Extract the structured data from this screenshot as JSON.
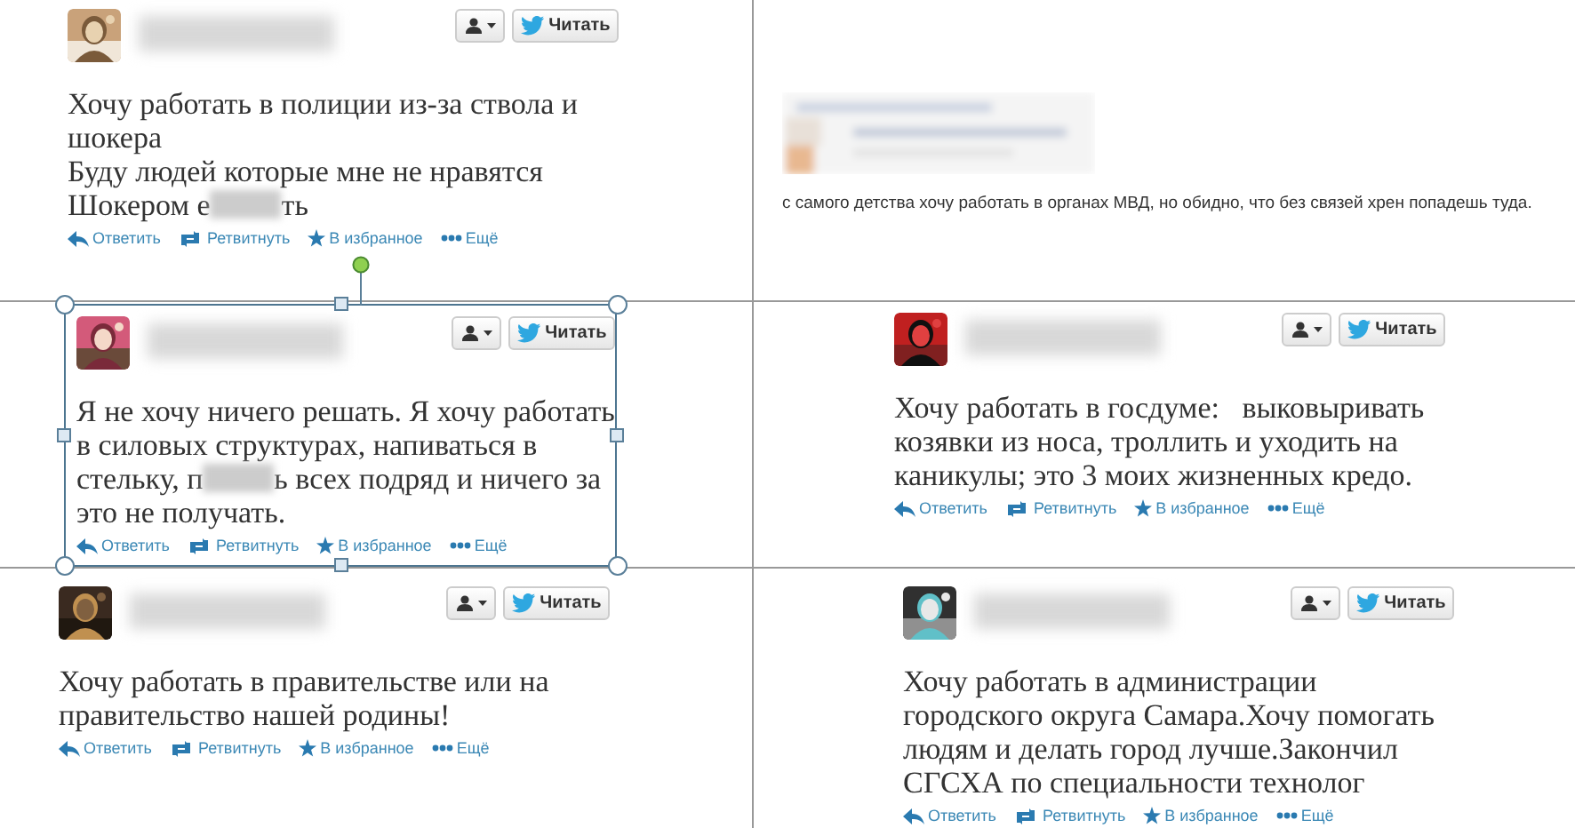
{
  "tweets": [
    {
      "kind": "tweet",
      "selected": false,
      "follow_label": "Читать",
      "lines": [
        [
          {
            "kind": "text",
            "text": "Хочу работать в полиции из-за ствола и"
          }
        ],
        [
          {
            "kind": "text",
            "text": "шокера"
          }
        ],
        [
          {
            "kind": "text",
            "text": "Буду людей которые мне не нравятся"
          }
        ],
        [
          {
            "kind": "text",
            "text": "Шокером е"
          },
          {
            "kind": "censored"
          },
          {
            "kind": "text",
            "text": "ть"
          }
        ]
      ],
      "actions": [
        {
          "kind": "reply",
          "label": "Ответить"
        },
        {
          "kind": "retweet",
          "label": "Ретвитнуть"
        },
        {
          "kind": "favorite",
          "label": "В избранное"
        },
        {
          "kind": "more",
          "label": "Ещё"
        }
      ]
    },
    {
      "kind": "post",
      "selected": false,
      "lines": [
        [
          {
            "kind": "text",
            "text": "с самого детства хочу работать в органах МВД, но обидно, что без связей хрен попадешь туда."
          }
        ]
      ]
    },
    {
      "kind": "tweet",
      "selected": true,
      "follow_label": "Читать",
      "lines": [
        [
          {
            "kind": "text",
            "text": "Я не хочу ничего решать. Я хочу работать"
          }
        ],
        [
          {
            "kind": "text",
            "text": "в силовых структурах, напиваться в"
          }
        ],
        [
          {
            "kind": "text",
            "text": "стельку, п"
          },
          {
            "kind": "censored"
          },
          {
            "kind": "text",
            "text": "ь всех подряд и ничего за"
          }
        ],
        [
          {
            "kind": "text",
            "text": "это не получать."
          }
        ]
      ],
      "actions": [
        {
          "kind": "reply",
          "label": "Ответить"
        },
        {
          "kind": "retweet",
          "label": "Ретвитнуть"
        },
        {
          "kind": "favorite",
          "label": "В избранное"
        },
        {
          "kind": "more",
          "label": "Ещё"
        }
      ]
    },
    {
      "kind": "tweet",
      "selected": false,
      "follow_label": "Читать",
      "lines": [
        [
          {
            "kind": "text",
            "text": "Хочу работать в госдуме:   выковыривать"
          }
        ],
        [
          {
            "kind": "text",
            "text": "козявки из носа, троллить и уходить на"
          }
        ],
        [
          {
            "kind": "text",
            "text": "каникулы; это 3 моих жизненных кредо."
          }
        ]
      ],
      "actions": [
        {
          "kind": "reply",
          "label": "Ответить"
        },
        {
          "kind": "retweet",
          "label": "Ретвитнуть"
        },
        {
          "kind": "favorite",
          "label": "В избранное"
        },
        {
          "kind": "more",
          "label": "Ещё"
        }
      ]
    },
    {
      "kind": "tweet",
      "selected": false,
      "follow_label": "Читать",
      "lines": [
        [
          {
            "kind": "text",
            "text": "Хочу работать в правительстве или на"
          }
        ],
        [
          {
            "kind": "text",
            "text": "правительство нашей родины!"
          }
        ]
      ],
      "actions": [
        {
          "kind": "reply",
          "label": "Ответить"
        },
        {
          "kind": "retweet",
          "label": "Ретвитнуть"
        },
        {
          "kind": "favorite",
          "label": "В избранное"
        },
        {
          "kind": "more",
          "label": "Ещё"
        }
      ]
    },
    {
      "kind": "tweet",
      "selected": false,
      "follow_label": "Читать",
      "lines": [
        [
          {
            "kind": "text",
            "text": "Хочу работать в администрации"
          }
        ],
        [
          {
            "kind": "text",
            "text": "городского округа Самара.Хочу помогать"
          }
        ],
        [
          {
            "kind": "text",
            "text": "людям и делать город лучше.Закончил"
          }
        ],
        [
          {
            "kind": "text",
            "text": "СГСХА по специальности технолог"
          }
        ]
      ],
      "actions": [
        {
          "kind": "reply",
          "label": "Ответить"
        },
        {
          "kind": "retweet",
          "label": "Ретвитнуть"
        },
        {
          "kind": "favorite",
          "label": "В избранное"
        },
        {
          "kind": "more",
          "label": "Ещё"
        }
      ]
    }
  ]
}
